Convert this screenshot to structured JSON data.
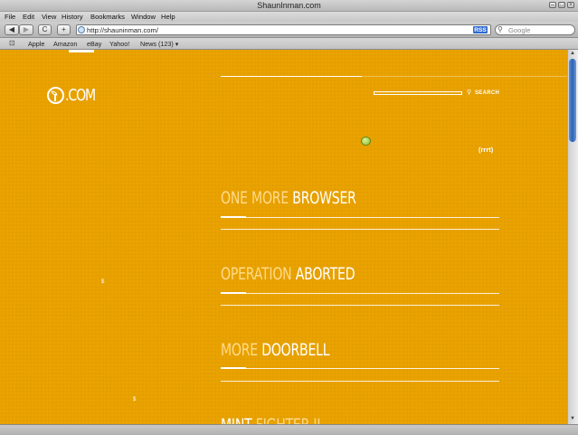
{
  "window": {
    "title": "ShaunInman.com"
  },
  "menu": [
    "File",
    "Edit",
    "View",
    "History",
    "Bookmarks",
    "Window",
    "Help"
  ],
  "toolbar": {
    "back": "◀",
    "forward": "▶",
    "reload": "C",
    "add": "+",
    "url": "http://shauninman.com/",
    "rss_badge": "RSS",
    "search_placeholder": "Google"
  },
  "bookmarks": [
    "Apple",
    "Amazon",
    "eBay",
    "Yahoo!",
    "News (123) ▾"
  ],
  "page": {
    "logo_text": ".COM",
    "search_label": "SEARCH",
    "rss_link": "(rrrt)",
    "posts": [
      {
        "title_a": "ONE MORE",
        "title_b": "BROWSER"
      },
      {
        "title_a": "OPERATION",
        "title_b": "ABORTED"
      },
      {
        "title_a": "MORE",
        "title_b": "DOORBELL"
      },
      {
        "title_a": "MINT",
        "title_b": "FIGHTER II"
      }
    ],
    "sidebar_marks": [
      "$",
      "$"
    ]
  },
  "colors": {
    "background": "#e9a200",
    "title_accent": "#ffda8a",
    "title_main": "#ffffff",
    "scroll_thumb": "#2c63b3"
  }
}
